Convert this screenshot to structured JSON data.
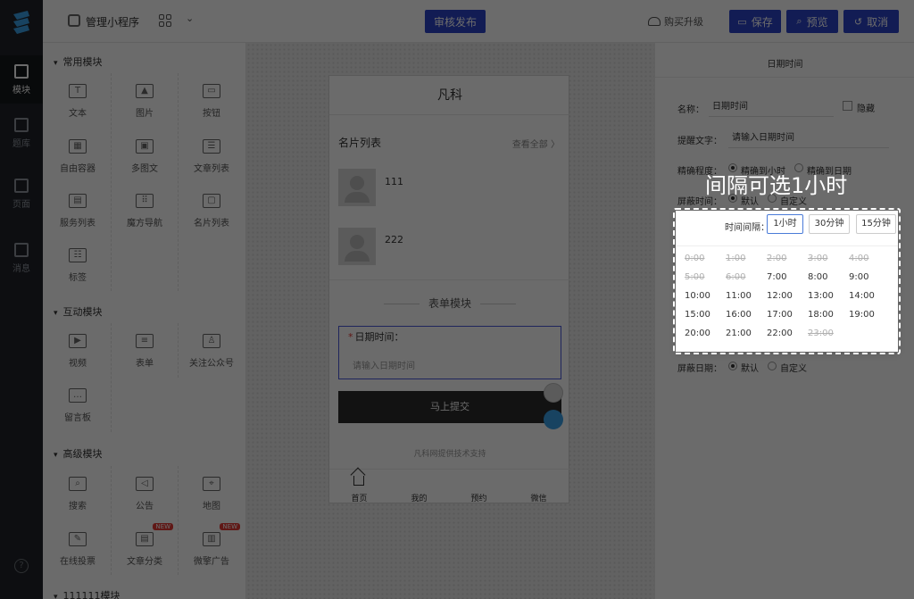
{
  "rail": {
    "items": [
      {
        "label": "模块",
        "active": true
      },
      {
        "label": "题库"
      },
      {
        "label": "页面"
      },
      {
        "label": "消息"
      }
    ],
    "help": "?"
  },
  "topbar": {
    "app_name": "管理小程序",
    "publish": "审核发布",
    "upgrade": "购买升级",
    "save": "保存",
    "preview": "预览",
    "cancel": "取消"
  },
  "components": {
    "common": {
      "title": "常用模块",
      "items": [
        {
          "label": "文本",
          "icon": "T"
        },
        {
          "label": "图片",
          "icon": "▲"
        },
        {
          "label": "按钮",
          "icon": "▭"
        },
        {
          "label": "自由容器",
          "icon": "▦"
        },
        {
          "label": "多图文",
          "icon": "▣"
        },
        {
          "label": "文章列表",
          "icon": "☰"
        },
        {
          "label": "服务列表",
          "icon": "▤"
        },
        {
          "label": "魔方导航",
          "icon": "⠿"
        },
        {
          "label": "名片列表",
          "icon": "▢"
        },
        {
          "label": "标签",
          "icon": "☷"
        }
      ]
    },
    "interactive": {
      "title": "互动模块",
      "items": [
        {
          "label": "视频",
          "icon": "▶"
        },
        {
          "label": "表单",
          "icon": "≡"
        },
        {
          "label": "关注公众号",
          "icon": "♙"
        },
        {
          "label": "留言板",
          "icon": "…"
        }
      ]
    },
    "advanced": {
      "title": "高级模块",
      "items": [
        {
          "label": "搜索",
          "icon": "⌕"
        },
        {
          "label": "公告",
          "icon": "◁"
        },
        {
          "label": "地图",
          "icon": "⌖"
        },
        {
          "label": "在线投票",
          "icon": "✎"
        },
        {
          "label": "文章分类",
          "icon": "▤",
          "badge": "NEW"
        },
        {
          "label": "微擎广告",
          "icon": "▥",
          "badge": "NEW"
        }
      ]
    },
    "custom": {
      "title": "111111模块"
    }
  },
  "phone": {
    "title": "凡科",
    "card_list_title": "名片列表",
    "card_list_more": "查看全部 〉",
    "cards": [
      {
        "name": "111"
      },
      {
        "name": "222"
      }
    ],
    "form_module_title": "表单模块",
    "field_label": "日期时间：",
    "field_placeholder": "请输入日期时间",
    "submit": "马上提交",
    "support": "凡科网提供技术支持",
    "nav": [
      "首页",
      "我的",
      "预约",
      "微信"
    ]
  },
  "props": {
    "title": "日期时间",
    "name_label": "名称：",
    "name_value": "日期时间",
    "hide_label": "隐藏",
    "hint_label": "提醒文字：",
    "hint_value": "请输入日期时间",
    "precision_label": "精确程度：",
    "precision_options": [
      "精确到小时",
      "精确到日期"
    ],
    "mask_time_label": "屏蔽时间：",
    "mask_time_options": [
      "默认",
      "自定义"
    ],
    "mask_date_label": "屏蔽日期：",
    "mask_date_options": [
      "默认",
      "自定义"
    ]
  },
  "dropdown": {
    "interval_label": "时间间隔：",
    "intervals": [
      "1小时",
      "30分钟",
      "15分钟"
    ],
    "selected_interval": "1小时",
    "times": [
      {
        "t": "0:00",
        "disabled": true
      },
      {
        "t": "1:00",
        "disabled": true
      },
      {
        "t": "2:00",
        "disabled": true
      },
      {
        "t": "3:00",
        "disabled": true
      },
      {
        "t": "4:00",
        "disabled": true
      },
      {
        "t": "5:00",
        "disabled": true
      },
      {
        "t": "6:00",
        "disabled": true
      },
      {
        "t": "7:00"
      },
      {
        "t": "8:00"
      },
      {
        "t": "9:00"
      },
      {
        "t": "10:00"
      },
      {
        "t": "11:00"
      },
      {
        "t": "12:00"
      },
      {
        "t": "13:00"
      },
      {
        "t": "14:00"
      },
      {
        "t": "15:00"
      },
      {
        "t": "16:00"
      },
      {
        "t": "17:00"
      },
      {
        "t": "18:00"
      },
      {
        "t": "19:00"
      },
      {
        "t": "20:00"
      },
      {
        "t": "21:00"
      },
      {
        "t": "22:00"
      },
      {
        "t": "23:00",
        "disabled": true
      }
    ]
  },
  "callout": "间隔可选1小时",
  "colors": {
    "brand": "#2d43c9",
    "overlay": "rgba(0,0,0,0.58)"
  }
}
